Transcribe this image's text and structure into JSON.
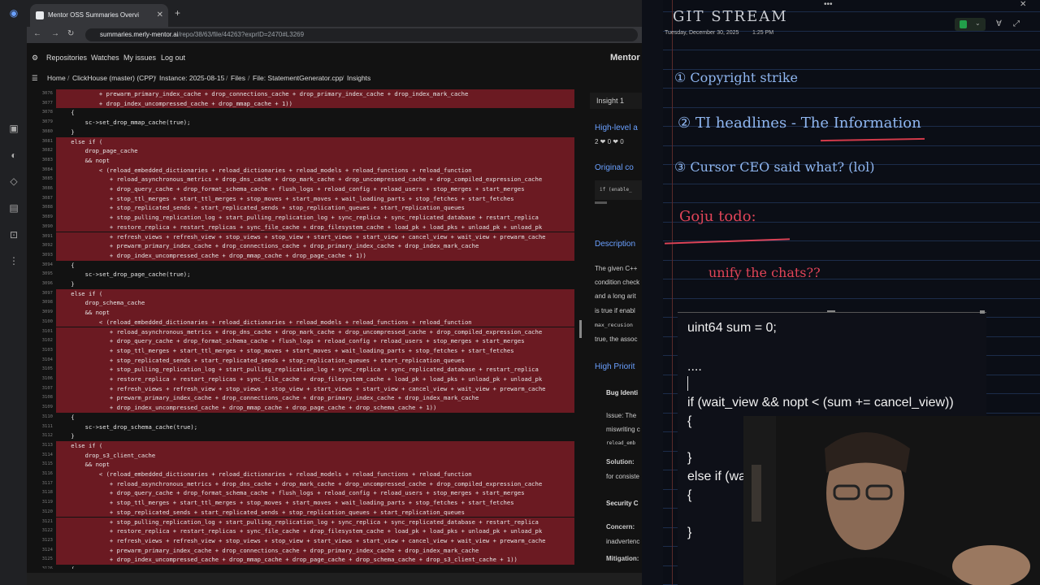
{
  "browser": {
    "tab_title": "Mentor OSS Summaries Overvi",
    "url_host": "summaries.merly-mentor.ai",
    "url_path": "/repo/38/63/file/44263?exprID=2470#L3269"
  },
  "app": {
    "brand": "Mentor",
    "nav": [
      "Repositories",
      "Watches",
      "My issues",
      "Log out"
    ]
  },
  "breadcrumb": [
    "Home",
    "ClickHouse (master) (CPP)",
    "Instance: 2025-08-15",
    "Files",
    "File: StatementGenerator.cpp",
    "Insights"
  ],
  "code_lines": [
    {
      "n": "3076",
      "t": "            + prewarm_primary_index_cache + drop_connections_cache + drop_primary_index_cache + drop_index_mark_cache",
      "hl": true
    },
    {
      "n": "3077",
      "t": "            + drop_index_uncompressed_cache + drop_mmap_cache + 1))",
      "hl": true
    },
    {
      "n": "3078",
      "t": "    {",
      "hl": false
    },
    {
      "n": "3079",
      "t": "        sc->set_drop_mmap_cache(true);",
      "hl": false
    },
    {
      "n": "3080",
      "t": "    }",
      "hl": false
    },
    {
      "n": "3081",
      "t": "    else if (",
      "hl": true
    },
    {
      "n": "3082",
      "t": "        drop_page_cache",
      "hl": true
    },
    {
      "n": "3083",
      "t": "        && nopt",
      "hl": true
    },
    {
      "n": "3084",
      "t": "            < (reload_embedded_dictionaries + reload_dictionaries + reload_models + reload_functions + reload_function",
      "hl": true
    },
    {
      "n": "3085",
      "t": "               + reload_asynchronous_metrics + drop_dns_cache + drop_mark_cache + drop_uncompressed_cache + drop_compiled_expression_cache",
      "hl": true
    },
    {
      "n": "3086",
      "t": "               + drop_query_cache + drop_format_schema_cache + flush_logs + reload_config + reload_users + stop_merges + start_merges",
      "hl": true
    },
    {
      "n": "3087",
      "t": "               + stop_ttl_merges + start_ttl_merges + stop_moves + start_moves + wait_loading_parts + stop_fetches + start_fetches",
      "hl": true
    },
    {
      "n": "3088",
      "t": "               + stop_replicated_sends + start_replicated_sends + stop_replication_queues + start_replication_queues",
      "hl": true
    },
    {
      "n": "3089",
      "t": "               + stop_pulling_replication_log + start_pulling_replication_log + sync_replica + sync_replicated_database + restart_replica",
      "hl": true
    },
    {
      "n": "3090",
      "t": "               + restore_replica + restart_replicas + sync_file_cache + drop_filesystem_cache + load_pk + load_pks + unload_pk + unload_pk",
      "hl": true
    },
    {
      "n": "3091",
      "t": "               + refresh_views + refresh_view + stop_views + stop_view + start_views + start_view + cancel_view + wait_view + prewarm_cache",
      "hl": true
    },
    {
      "n": "3092",
      "t": "               + prewarm_primary_index_cache + drop_connections_cache + drop_primary_index_cache + drop_index_mark_cache",
      "hl": true
    },
    {
      "n": "3093",
      "t": "               + drop_index_uncompressed_cache + drop_mmap_cache + drop_page_cache + 1))",
      "hl": true
    },
    {
      "n": "3094",
      "t": "    {",
      "hl": false
    },
    {
      "n": "3095",
      "t": "        sc->set_drop_page_cache(true);",
      "hl": false
    },
    {
      "n": "3096",
      "t": "    }",
      "hl": false
    },
    {
      "n": "3097",
      "t": "    else if (",
      "hl": true
    },
    {
      "n": "3098",
      "t": "        drop_schema_cache",
      "hl": true
    },
    {
      "n": "3099",
      "t": "        && nopt",
      "hl": true
    },
    {
      "n": "3100",
      "t": "            < (reload_embedded_dictionaries + reload_dictionaries + reload_models + reload_functions + reload_function",
      "hl": true
    },
    {
      "n": "3101",
      "t": "               + reload_asynchronous_metrics + drop_dns_cache + drop_mark_cache + drop_uncompressed_cache + drop_compiled_expression_cache",
      "hl": true
    },
    {
      "n": "3102",
      "t": "               + drop_query_cache + drop_format_schema_cache + flush_logs + reload_config + reload_users + stop_merges + start_merges",
      "hl": true
    },
    {
      "n": "3103",
      "t": "               + stop_ttl_merges + start_ttl_merges + stop_moves + start_moves + wait_loading_parts + stop_fetches + start_fetches",
      "hl": true
    },
    {
      "n": "3104",
      "t": "               + stop_replicated_sends + start_replicated_sends + stop_replication_queues + start_replication_queues",
      "hl": true
    },
    {
      "n": "3105",
      "t": "               + stop_pulling_replication_log + start_pulling_replication_log + sync_replica + sync_replicated_database + restart_replica",
      "hl": true
    },
    {
      "n": "3106",
      "t": "               + restore_replica + restart_replicas + sync_file_cache + drop_filesystem_cache + load_pk + load_pks + unload_pk + unload_pk",
      "hl": true
    },
    {
      "n": "3107",
      "t": "               + refresh_views + refresh_view + stop_views + stop_view + start_views + start_view + cancel_view + wait_view + prewarm_cache",
      "hl": true
    },
    {
      "n": "3108",
      "t": "               + prewarm_primary_index_cache + drop_connections_cache + drop_primary_index_cache + drop_index_mark_cache",
      "hl": true
    },
    {
      "n": "3109",
      "t": "               + drop_index_uncompressed_cache + drop_mmap_cache + drop_page_cache + drop_schema_cache + 1))",
      "hl": true
    },
    {
      "n": "3110",
      "t": "    {",
      "hl": false
    },
    {
      "n": "3111",
      "t": "        sc->set_drop_schema_cache(true);",
      "hl": false
    },
    {
      "n": "3112",
      "t": "    }",
      "hl": false
    },
    {
      "n": "3113",
      "t": "    else if (",
      "hl": true
    },
    {
      "n": "3114",
      "t": "        drop_s3_client_cache",
      "hl": true
    },
    {
      "n": "3115",
      "t": "        && nopt",
      "hl": true
    },
    {
      "n": "3116",
      "t": "            < (reload_embedded_dictionaries + reload_dictionaries + reload_models + reload_functions + reload_function",
      "hl": true
    },
    {
      "n": "3117",
      "t": "               + reload_asynchronous_metrics + drop_dns_cache + drop_mark_cache + drop_uncompressed_cache + drop_compiled_expression_cache",
      "hl": true
    },
    {
      "n": "3118",
      "t": "               + drop_query_cache + drop_format_schema_cache + flush_logs + reload_config + reload_users + stop_merges + start_merges",
      "hl": true
    },
    {
      "n": "3119",
      "t": "               + stop_ttl_merges + start_ttl_merges + stop_moves + start_moves + wait_loading_parts + stop_fetches + start_fetches",
      "hl": true
    },
    {
      "n": "3120",
      "t": "               + stop_replicated_sends + start_replicated_sends + stop_replication_queues + start_replication_queues",
      "hl": true
    },
    {
      "n": "3121",
      "t": "               + stop_pulling_replication_log + start_pulling_replication_log + sync_replica + sync_replicated_database + restart_replica",
      "hl": true
    },
    {
      "n": "3122",
      "t": "               + restore_replica + restart_replicas + sync_file_cache + drop_filesystem_cache + load_pk + load_pks + unload_pk + unload_pk",
      "hl": true
    },
    {
      "n": "3123",
      "t": "               + refresh_views + refresh_view + stop_views + stop_view + start_views + start_view + cancel_view + wait_view + prewarm_cache",
      "hl": true
    },
    {
      "n": "3124",
      "t": "               + prewarm_primary_index_cache + drop_connections_cache + drop_primary_index_cache + drop_index_mark_cache",
      "hl": true
    },
    {
      "n": "3125",
      "t": "               + drop_index_uncompressed_cache + drop_mmap_cache + drop_page_cache + drop_schema_cache + drop_s3_client_cache + 1))",
      "hl": true
    },
    {
      "n": "3126",
      "t": "    {",
      "hl": false
    }
  ],
  "insight": {
    "title": "Insight 1",
    "high_level": "High-level a",
    "votes": "2 ❤ 0 ❤ 0",
    "original_code": "Original co",
    "snippet": "if (enable_",
    "description_h": "Description",
    "desc_lines": [
      "The given C++",
      "condition check",
      "and a long arit",
      "is true if enabl",
      "max_recusion",
      "true, the assoc"
    ],
    "high_priority": "High Priorit",
    "bug_ident": "Bug Identi",
    "issue": "Issue: The",
    "miswriting": "miswriting c",
    "reload": "reload_emb",
    "solution": "Solution:",
    "for_consist": "for consiste",
    "security": "Security C",
    "concern": "Concern:",
    "inadvertent": "inadvertenc",
    "mitigation": "Mitigation:"
  },
  "notes": {
    "title": "GIT STREAM",
    "date": "Tuesday, December 30, 2025",
    "time": "1:25 PM",
    "items": [
      "① Copyright strike",
      "② TI headlines - The Information",
      "③ Cursor CEO said what? (lol)"
    ],
    "todo_title": "Goju todo:",
    "todo_item": "unify the chats??",
    "code": [
      "uint64 sum = 0;",
      "....",
      "if (wait_view && nopt < (sum += cancel_view))",
      "{",
      "}",
      "else if (wa",
      "{",
      "}"
    ]
  }
}
